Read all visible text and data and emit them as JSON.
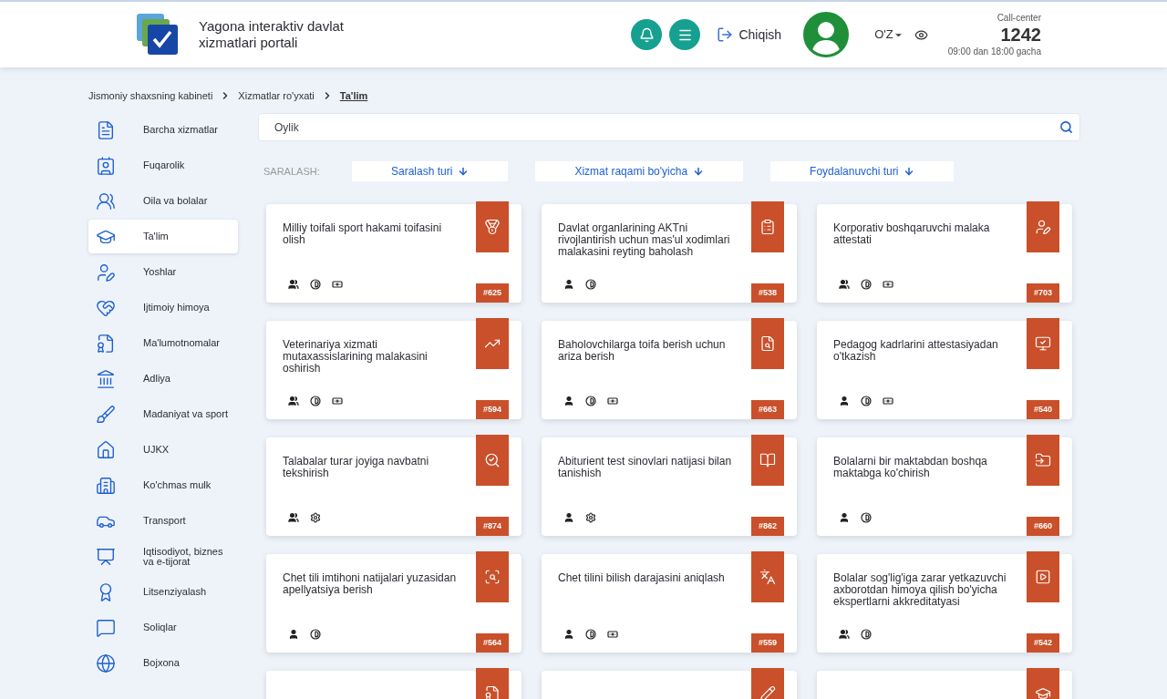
{
  "header": {
    "title": "Yagona interaktiv davlat xizmatlari portali",
    "logout": "Chiqish",
    "language": "O'Z",
    "call_center": {
      "label": "Call-center",
      "number": "1242",
      "hours": "09:00 dan 18:00 gacha"
    }
  },
  "breadcrumbs": [
    {
      "label": "Jismoniy shaxsning kabineti",
      "current": false
    },
    {
      "label": "Xizmatlar ro'yxati",
      "current": false
    },
    {
      "label": "Ta'lim",
      "current": true
    }
  ],
  "sidebar": {
    "items": [
      {
        "label": "Barcha xizmatlar",
        "selected": false
      },
      {
        "label": "Fuqarolik",
        "selected": false
      },
      {
        "label": "Oila va bolalar",
        "selected": false
      },
      {
        "label": "Ta'lim",
        "selected": true
      },
      {
        "label": "Yoshlar",
        "selected": false
      },
      {
        "label": "Ijtimoiy himoya",
        "selected": false
      },
      {
        "label": "Ma'lumotnomalar",
        "selected": false
      },
      {
        "label": "Adliya",
        "selected": false
      },
      {
        "label": "Madaniyat va sport",
        "selected": false
      },
      {
        "label": "UJKX",
        "selected": false
      },
      {
        "label": "Ko'chmas mulk",
        "selected": false
      },
      {
        "label": "Transport",
        "selected": false
      },
      {
        "label": "Iqtisodiyot, biznes va e-tijorat",
        "selected": false
      },
      {
        "label": "Litsenziyalash",
        "selected": false
      },
      {
        "label": "Soliqlar",
        "selected": false
      },
      {
        "label": "Bojxona",
        "selected": false
      }
    ]
  },
  "search": {
    "value": "Oylik"
  },
  "sorting": {
    "label": "SARALASH:",
    "buttons": [
      "Saralash turi",
      "Xizmat raqami bo'yicha",
      "Foydalanuvchi turi"
    ]
  },
  "cards": [
    {
      "kind": "full",
      "title": "Milliy toifali sport hakami toifasini olish",
      "number": "#625",
      "tags": [
        {
          "kind": "group"
        },
        {
          "kind": "half"
        },
        {
          "kind": "money"
        }
      ]
    },
    {
      "kind": "full",
      "title": "Davlat organlarining AKTni rivojlantirish uchun mas'ul xodimlari malakasini reyting baholash",
      "number": "#538",
      "tags": [
        {
          "kind": "person"
        },
        {
          "kind": "half"
        }
      ]
    },
    {
      "kind": "full",
      "title": "Korporativ boshqaruvchi malaka attestati",
      "number": "#703",
      "tags": [
        {
          "kind": "group"
        },
        {
          "kind": "half"
        },
        {
          "kind": "money"
        }
      ]
    },
    {
      "kind": "full",
      "title": "Veterinariya xizmati mutaxassislarining malakasini oshirish",
      "number": "#594",
      "tags": [
        {
          "kind": "group"
        },
        {
          "kind": "half"
        },
        {
          "kind": "money"
        }
      ]
    },
    {
      "kind": "full",
      "title": "Baholovchilarga toifa berish uchun ariza berish",
      "number": "#663",
      "tags": [
        {
          "kind": "person"
        },
        {
          "kind": "half"
        },
        {
          "kind": "money"
        }
      ]
    },
    {
      "kind": "full",
      "title": "Pedagog kadrlarini attestasiyadan o'tkazish",
      "number": "#540",
      "tags": [
        {
          "kind": "person"
        },
        {
          "kind": "half"
        },
        {
          "kind": "money"
        }
      ]
    },
    {
      "kind": "full",
      "title": "Talabalar turar joyiga navbatni tekshirish",
      "number": "#874",
      "tags": [
        {
          "kind": "group"
        },
        {
          "kind": "gear"
        }
      ]
    },
    {
      "kind": "full",
      "title": "Abiturient test sinovlari natijasi bilan tanishish",
      "number": "#862",
      "tags": [
        {
          "kind": "person"
        },
        {
          "kind": "gear"
        }
      ]
    },
    {
      "kind": "full",
      "title": "Bolalarni bir maktabdan boshqa maktabga ko'chirish",
      "number": "#660",
      "tags": [
        {
          "kind": "person"
        },
        {
          "kind": "half"
        }
      ]
    },
    {
      "kind": "full",
      "title": "Chet tili imtihoni natijalari yuzasidan apellyatsiya berish",
      "number": "#564",
      "tags": [
        {
          "kind": "person"
        },
        {
          "kind": "half"
        }
      ]
    },
    {
      "kind": "full",
      "title": "Chet tilini bilish darajasini aniqlash",
      "number": "#559",
      "tags": [
        {
          "kind": "person"
        },
        {
          "kind": "half"
        },
        {
          "kind": "money"
        }
      ]
    },
    {
      "kind": "full",
      "title": "Bolalar sog'lig'iga zarar yetkazuvchi axborotdan himoya qilish bo'yicha ekspertlarni akkreditatyasi",
      "number": "#542",
      "tags": [
        {
          "kind": "group"
        },
        {
          "kind": "half"
        }
      ]
    },
    {
      "kind": "cut"
    },
    {
      "kind": "cut"
    },
    {
      "kind": "cut"
    }
  ]
}
